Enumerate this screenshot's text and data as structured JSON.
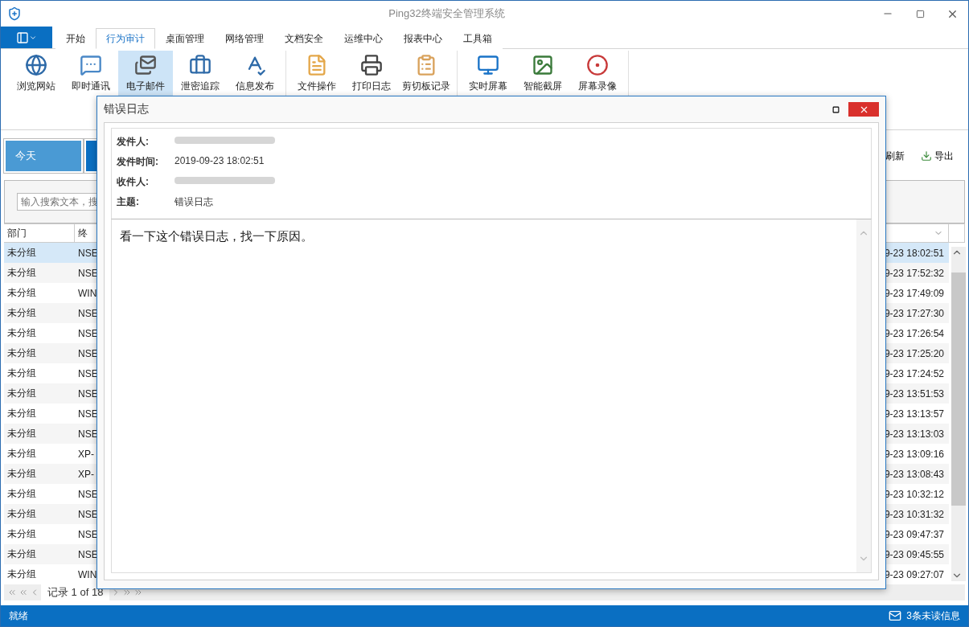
{
  "window": {
    "title": "Ping32终端安全管理系统"
  },
  "ribbon_tabs": [
    {
      "label": "开始",
      "selected": false
    },
    {
      "label": "行为审计",
      "selected": true
    },
    {
      "label": "桌面管理",
      "selected": false
    },
    {
      "label": "网络管理",
      "selected": false
    },
    {
      "label": "文档安全",
      "selected": false
    },
    {
      "label": "运维中心",
      "selected": false
    },
    {
      "label": "报表中心",
      "selected": false
    },
    {
      "label": "工具箱",
      "selected": false
    }
  ],
  "ribbon_groups": [
    [
      {
        "label": "浏览网站",
        "selected": false
      },
      {
        "label": "即时通讯",
        "selected": false
      },
      {
        "label": "电子邮件",
        "selected": true
      },
      {
        "label": "泄密追踪",
        "selected": false
      },
      {
        "label": "信息发布",
        "selected": false
      }
    ],
    [
      {
        "label": "文件操作",
        "selected": false
      },
      {
        "label": "打印日志",
        "selected": false
      },
      {
        "label": "剪切板记录",
        "selected": false
      }
    ],
    [
      {
        "label": "实时屏幕",
        "selected": false
      },
      {
        "label": "智能截屏",
        "selected": false
      },
      {
        "label": "屏幕录像",
        "selected": false
      }
    ]
  ],
  "date_tabs": [
    {
      "label": "今天",
      "selected": true
    },
    {
      "selected": false
    }
  ],
  "toolbar": {
    "refresh": "刷新",
    "export": "导出"
  },
  "search": {
    "placeholder": "输入搜索文本，搜"
  },
  "table": {
    "columns": [
      "部门",
      "终"
    ],
    "rows": [
      {
        "dept": "未分组",
        "column_2": "NSE",
        "time": "9-23 18:02:51",
        "selected": true
      },
      {
        "dept": "未分组",
        "column_2": "NSE",
        "time": "9-23 17:52:32",
        "selected": false
      },
      {
        "dept": "未分组",
        "column_2": "WIN",
        "time": "9-23 17:49:09",
        "selected": false
      },
      {
        "dept": "未分组",
        "column_2": "NSE",
        "time": "9-23 17:27:30",
        "selected": false
      },
      {
        "dept": "未分组",
        "column_2": "NSE",
        "time": "9-23 17:26:54",
        "selected": false
      },
      {
        "dept": "未分组",
        "column_2": "NSE",
        "time": "9-23 17:25:20",
        "selected": false
      },
      {
        "dept": "未分组",
        "column_2": "NSE",
        "time": "9-23 17:24:52",
        "selected": false
      },
      {
        "dept": "未分组",
        "column_2": "NSE",
        "time": "9-23 13:51:53",
        "selected": false
      },
      {
        "dept": "未分组",
        "column_2": "NSE",
        "time": "9-23 13:13:57",
        "selected": false
      },
      {
        "dept": "未分组",
        "column_2": "NSE",
        "time": "9-23 13:13:03",
        "selected": false
      },
      {
        "dept": "未分组",
        "column_2": "XP-",
        "time": "9-23 13:09:16",
        "selected": false
      },
      {
        "dept": "未分组",
        "column_2": "XP-",
        "time": "9-23 13:08:43",
        "selected": false
      },
      {
        "dept": "未分组",
        "column_2": "NSE",
        "time": "9-23 10:32:12",
        "selected": false
      },
      {
        "dept": "未分组",
        "column_2": "NSE",
        "time": "9-23 10:31:32",
        "selected": false
      },
      {
        "dept": "未分组",
        "column_2": "NSE",
        "time": "9-23 09:47:37",
        "selected": false
      },
      {
        "dept": "未分组",
        "column_2": "NSE",
        "time": "9-23 09:45:55",
        "selected": false
      },
      {
        "dept": "未分组",
        "column_2": "WIN",
        "time": "9-23 09:27:07",
        "selected": false
      }
    ]
  },
  "pager": {
    "label": "记录 1 of 18"
  },
  "status_bar": {
    "left": "就绪",
    "right": "3条未读信息"
  },
  "dialog": {
    "title": "错误日志",
    "fields": [
      {
        "label": "发件人:",
        "redacted": true
      },
      {
        "label": "发件时间:",
        "value": "2019-09-23 18:02:51",
        "redacted": false
      },
      {
        "label": "收件人:",
        "redacted": true
      },
      {
        "label": "主题:",
        "value": "错误日志",
        "redacted": false
      }
    ],
    "body": "看一下这个错误日志，找一下原因。"
  }
}
